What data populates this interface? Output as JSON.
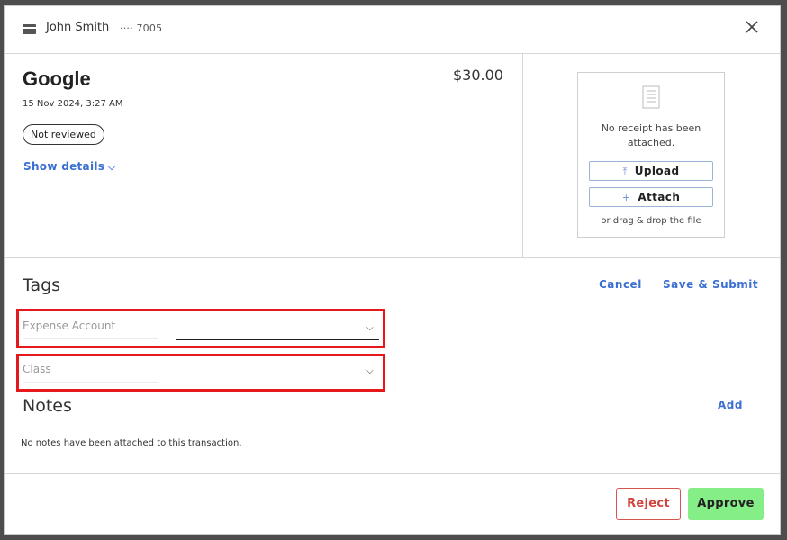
{
  "header": {
    "cardholder": "John Smith",
    "card_last4": "···· 7005"
  },
  "transaction": {
    "merchant": "Google",
    "date": "15 Nov 2024, 3:27 AM",
    "amount": "$30.00",
    "status": "Not reviewed",
    "show_details_label": "Show details"
  },
  "receipt": {
    "message": "No receipt has been attached.",
    "upload_label": "Upload",
    "attach_label": "Attach",
    "drag_text": "or drag & drop the file"
  },
  "tags": {
    "title": "Tags",
    "cancel_label": "Cancel",
    "save_label": "Save & Submit",
    "fields": [
      {
        "placeholder": "Expense Account"
      },
      {
        "placeholder": "Class"
      }
    ]
  },
  "notes": {
    "title": "Notes",
    "add_label": "Add",
    "empty_text": "No notes have been attached to this transaction."
  },
  "actions": {
    "reject_label": "Reject",
    "approve_label": "Approve"
  },
  "colors": {
    "accent_link": "#3b6fd1",
    "approve_bg": "#86ee86",
    "reject_border": "#d9534f",
    "highlight_box": "#e5191b"
  },
  "icons": {
    "card": "card-icon",
    "close": "close-icon",
    "document": "document-icon",
    "upload": "upload-icon",
    "attach": "plus-icon",
    "chevron": "chevron-down-icon"
  }
}
